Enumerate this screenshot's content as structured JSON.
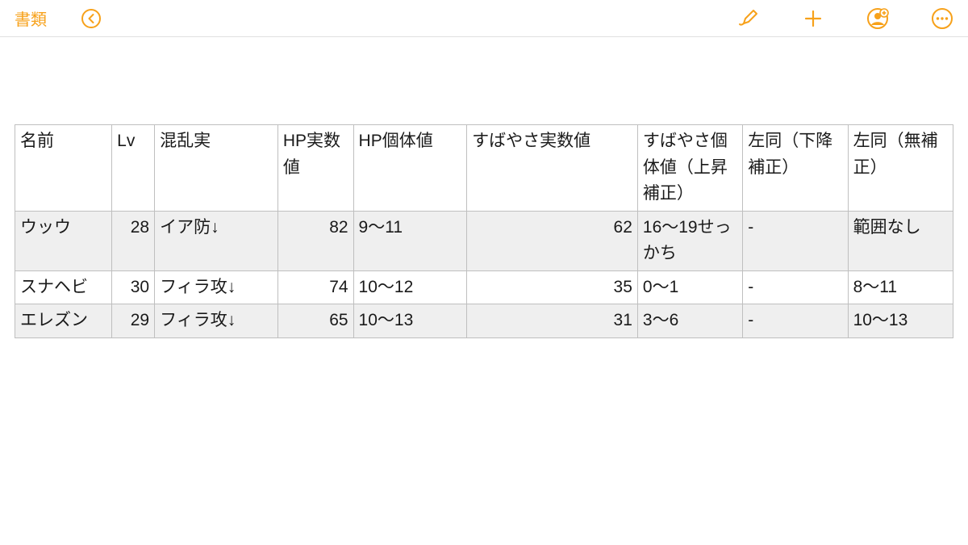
{
  "toolbar": {
    "back_label": "書類"
  },
  "table": {
    "headers": {
      "name": "名前",
      "lv": "Lv",
      "berry": "混乱実",
      "hp_actual": "HP実数値",
      "hp_iv": "HP個体値",
      "speed_actual": "すばやさ実数値",
      "speed_iv_up": "すばやさ個体値（上昇補正）",
      "speed_iv_down": "左同（下降補正）",
      "speed_iv_none": "左同（無補正）"
    },
    "rows": [
      {
        "name": "ウッウ",
        "lv": "28",
        "berry": "イア防↓",
        "hp_actual": "82",
        "hp_iv": "9〜11",
        "speed_actual": "62",
        "speed_iv_up": "16〜19せっかち",
        "speed_iv_down": "-",
        "speed_iv_none": "範囲なし"
      },
      {
        "name": "スナヘビ",
        "lv": "30",
        "berry": "フィラ攻↓",
        "hp_actual": "74",
        "hp_iv": "10〜12",
        "speed_actual": "35",
        "speed_iv_up": "0〜1",
        "speed_iv_down": "-",
        "speed_iv_none": "8〜11"
      },
      {
        "name": "エレズン",
        "lv": "29",
        "berry": "フィラ攻↓",
        "hp_actual": "65",
        "hp_iv": "10〜13",
        "speed_actual": "31",
        "speed_iv_up": "3〜6",
        "speed_iv_down": "-",
        "speed_iv_none": "10〜13"
      }
    ]
  }
}
